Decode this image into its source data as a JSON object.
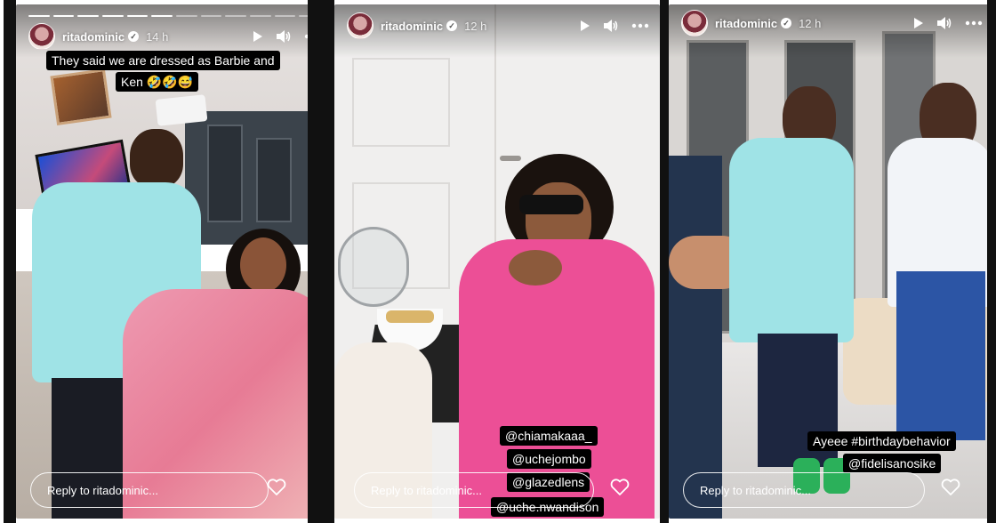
{
  "stories": [
    {
      "username": "ritadominic",
      "time": "14 h",
      "caption_line1": "They said we are dressed as Barbie and",
      "caption_line2": "Ken 🤣🤣😅",
      "reply_placeholder": "Reply to ritadominic...",
      "progress_segments": 12,
      "progress_done": 6
    },
    {
      "username": "ritadominic",
      "time": "12 h",
      "tags": [
        "@chiamakaaa_",
        "@uchejombo",
        "@glazedlens",
        "@uche.nwandison"
      ],
      "reply_placeholder": "Reply to ritadominic..."
    },
    {
      "username": "ritadominic",
      "time": "12 h",
      "caption_line1": "Ayeee #birthdaybehavior",
      "caption_line2": "@fidelisanosike",
      "reply_placeholder": "Reply to ritadominic..."
    }
  ],
  "icons": {
    "play": "play-icon",
    "volume": "volume-icon",
    "more": "more-options-icon",
    "heart": "heart-icon",
    "verified": "verified-badge-icon"
  },
  "colors": {
    "shirt_blue": "#9fe3e6",
    "pink_outfit": "#ec4f96",
    "caption_bg": "#000000"
  }
}
